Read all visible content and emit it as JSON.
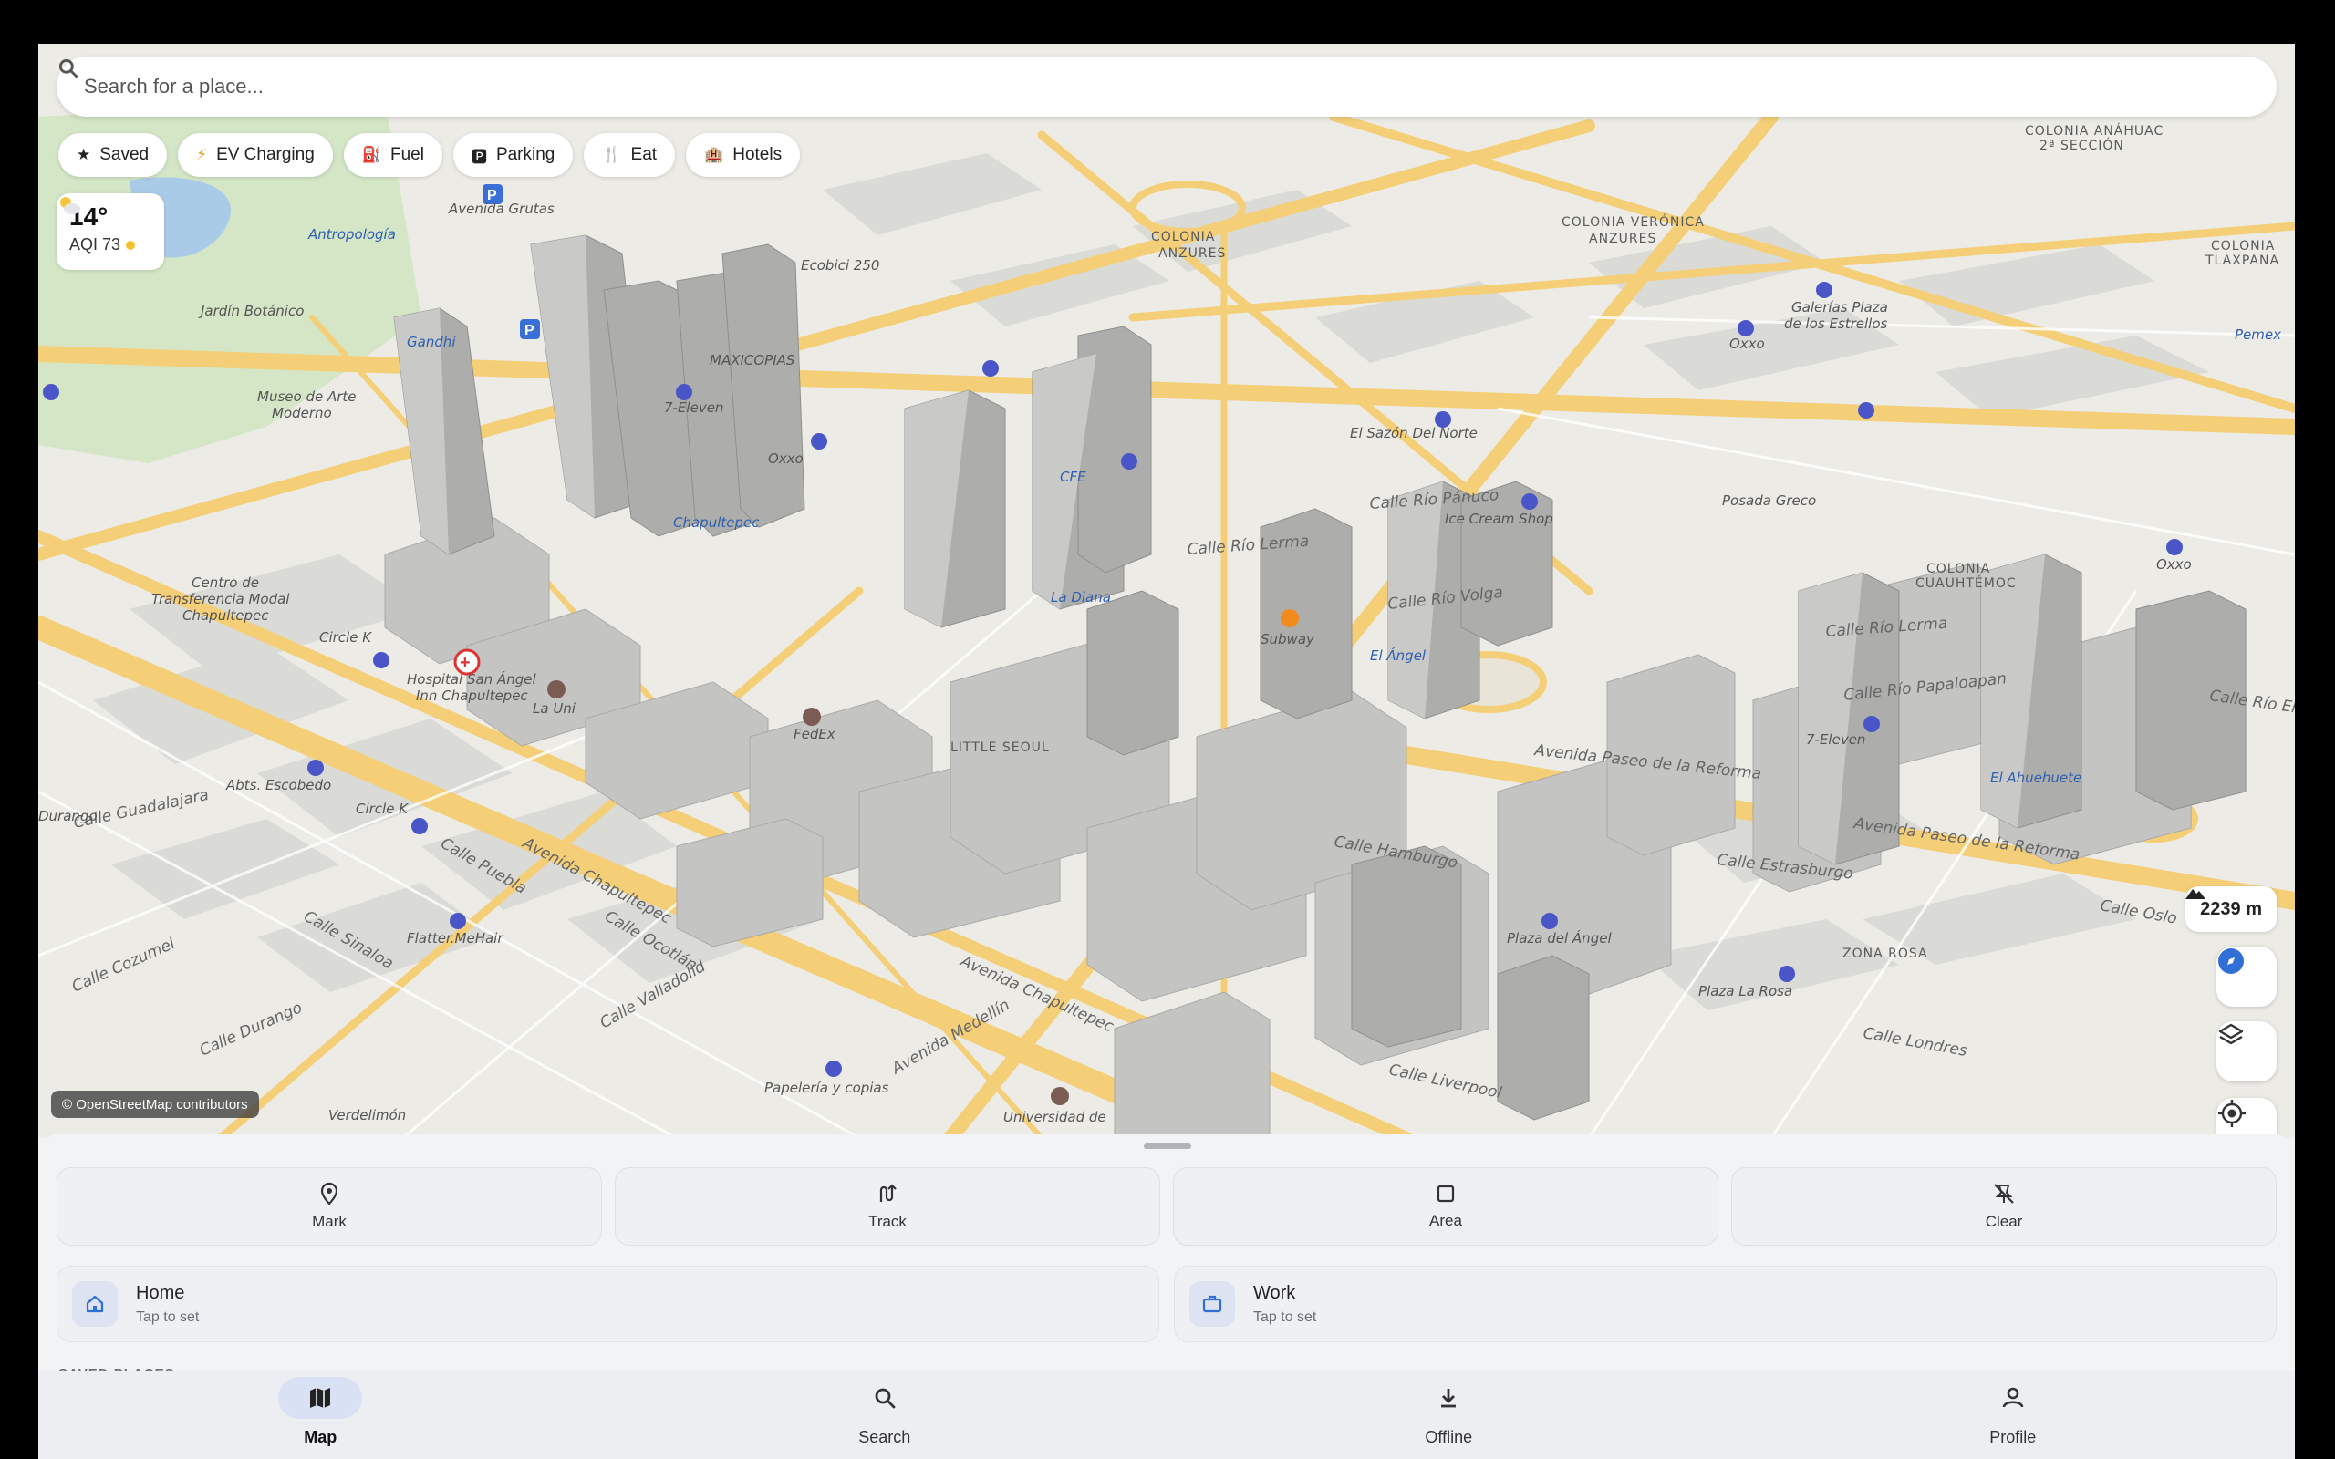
{
  "search": {
    "placeholder": "Search for a place..."
  },
  "chips": [
    {
      "label": "Saved",
      "icon": "star-icon",
      "glyph": "★"
    },
    {
      "label": "EV Charging",
      "icon": "lightning-icon",
      "glyph": "⚡"
    },
    {
      "label": "Fuel",
      "icon": "fuel-icon",
      "glyph": "⛽"
    },
    {
      "label": "Parking",
      "icon": "parking-icon",
      "glyph": "🅿"
    },
    {
      "label": "Eat",
      "icon": "utensils-icon",
      "glyph": "🍴"
    },
    {
      "label": "Hotels",
      "icon": "hotel-icon",
      "glyph": "🏨"
    }
  ],
  "weather": {
    "temp": "14°",
    "aqi": "AQI 73",
    "aqi_color": "#f2c230",
    "icon": "partly-sunny-icon"
  },
  "elevation": {
    "value": "2239 m"
  },
  "attribution": "© OpenStreetMap contributors",
  "map_labels": {
    "areas": [
      "COLONIA ANZURES",
      "COLONIA VERÓNICA ANZURES",
      "COLONIA ANÁHUAC 2ª SECCIÓN",
      "COLONIA TLAXPANA",
      "COLONIA CUAUHTÉMOC",
      "ZONA ROSA",
      "LITTLE SEOUL"
    ],
    "pois": [
      "Antropología",
      "Jardín Botánico",
      "Museo de Arte Moderno",
      "Gandhi",
      "Avenida Grutas",
      "MAXICOPIAS",
      "7-Eleven",
      "Oxxo",
      "Ecobici 250",
      "CFE",
      "Chapultepec",
      "La Diana",
      "El Ángel",
      "Subway",
      "El Sazón Del Norte",
      "Ice Cream Shop",
      "Posada Greco",
      "Galerías Plaza de los Estrellos",
      "Pemex",
      "Centro de Transferencia Modal Chapultepec",
      "Circle K",
      "Hospital San Ángel Inn Chapultepec",
      "La Uni",
      "FedEx",
      "Abts. Escobedo",
      "Durango",
      "Flatter.MeHair",
      "Papelería y copias",
      "Universidad de",
      "Verdelimón",
      "Plaza del Ángel",
      "Plaza La Rosa",
      "El Ahuehuete",
      "Avenida Chapultepec",
      "Avenida Paseo de la Reforma",
      "Calle Londres",
      "Calle Liverpool",
      "Calle Hamburgo",
      "Calle Estrasburgo",
      "Calle Oslo",
      "Calle Puebla",
      "Calle Sinaloa",
      "Calle Cozumel",
      "Calle Durango",
      "Calle Guadalajara",
      "Calle Ocotlán",
      "Calle Valladolid",
      "Avenida Medellín",
      "Calle Río Lerma",
      "Calle Río Pánuco",
      "Calle Río Volga",
      "Calle Río Papaloapan",
      "Calle Río Elba"
    ]
  },
  "actions": [
    {
      "label": "Mark",
      "icon": "pin-icon"
    },
    {
      "label": "Track",
      "icon": "route-icon"
    },
    {
      "label": "Area",
      "icon": "square-icon"
    },
    {
      "label": "Clear",
      "icon": "clear-pins-icon"
    }
  ],
  "places": {
    "home": {
      "title": "Home",
      "subtitle": "Tap to set",
      "icon": "home-icon"
    },
    "work": {
      "title": "Work",
      "subtitle": "Tap to set",
      "icon": "briefcase-icon"
    }
  },
  "saved_section_label": "SAVED PLACES",
  "nav": [
    {
      "label": "Map",
      "icon": "map-icon",
      "active": true
    },
    {
      "label": "Search",
      "icon": "search-icon",
      "active": false
    },
    {
      "label": "Offline",
      "icon": "download-icon",
      "active": false
    },
    {
      "label": "Profile",
      "icon": "person-icon",
      "active": false
    }
  ],
  "colors": {
    "accent": "#2f6fd6",
    "road": "#f7d27a",
    "building": "#b9b9b9",
    "park": "#cfe3c0"
  }
}
